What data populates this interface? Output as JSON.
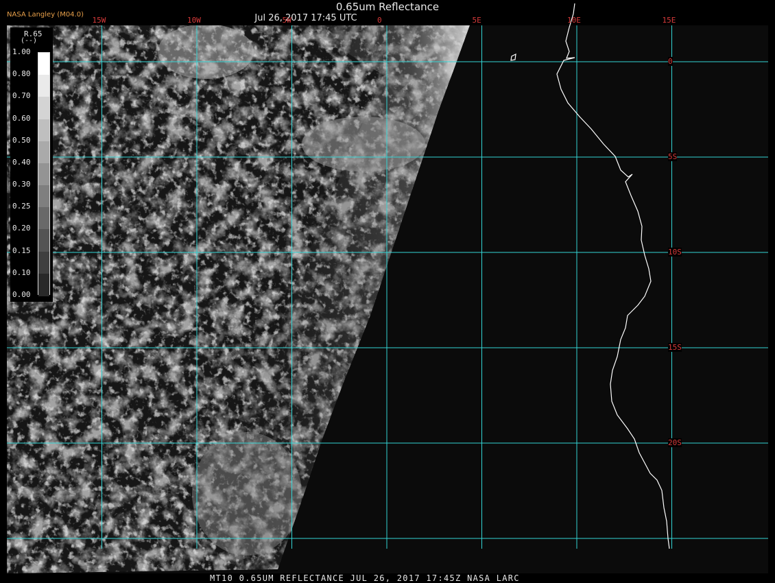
{
  "producer": "NASA Langley (M04.0)",
  "title": "0.65um Reflectance",
  "subtitle": "Jul 26, 2017 17:45 UTC",
  "footer": "MT10  0.65UM REFLECTANCE   JUL 26, 2017 17:45Z   NASA LARC",
  "colors": {
    "grid": "#33d6d6",
    "labels": "#d83a3a",
    "coast": "#ffffff",
    "background": "#0a0a0a"
  },
  "legend": {
    "variable": "R.65",
    "unit": "(--)",
    "ticks": [
      "1.00",
      "0.80",
      "0.70",
      "0.60",
      "0.50",
      "0.40",
      "0.30",
      "0.25",
      "0.20",
      "0.15",
      "0.10",
      "0.00"
    ]
  },
  "longitude_labels": [
    {
      "text": "15W",
      "lon": -15
    },
    {
      "text": "10W",
      "lon": -10
    },
    {
      "text": "5W",
      "lon": -5
    },
    {
      "text": "0",
      "lon": 0
    },
    {
      "text": "5E",
      "lon": 5
    },
    {
      "text": "10E",
      "lon": 10
    },
    {
      "text": "15E",
      "lon": 15
    }
  ],
  "latitude_labels": [
    {
      "text": "0",
      "lat": 0
    },
    {
      "text": "5S",
      "lat": -5
    },
    {
      "text": "10S",
      "lat": -10
    },
    {
      "text": "15S",
      "lat": -15
    },
    {
      "text": "20S",
      "lat": -20
    }
  ]
}
